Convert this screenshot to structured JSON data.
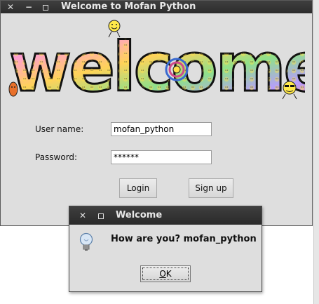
{
  "main_window": {
    "title": "Welcome to Mofan Python",
    "close_glyph": "✕",
    "minimize_glyph": "−",
    "banner_text": "welcome",
    "form": {
      "username_label": "User name:",
      "username_value": "mofan_python",
      "password_label": "Password:",
      "password_value": "******"
    },
    "buttons": {
      "login": "Login",
      "signup": "Sign up"
    }
  },
  "dialog": {
    "title": "Welcome",
    "close_glyph": "✕",
    "icon": "lightbulb-icon",
    "message": "How are you? mofan_python",
    "ok_accel": "O",
    "ok_rest": "K"
  },
  "colors": {
    "titlebar": "#2f2f2f",
    "window_bg": "#dedede"
  }
}
